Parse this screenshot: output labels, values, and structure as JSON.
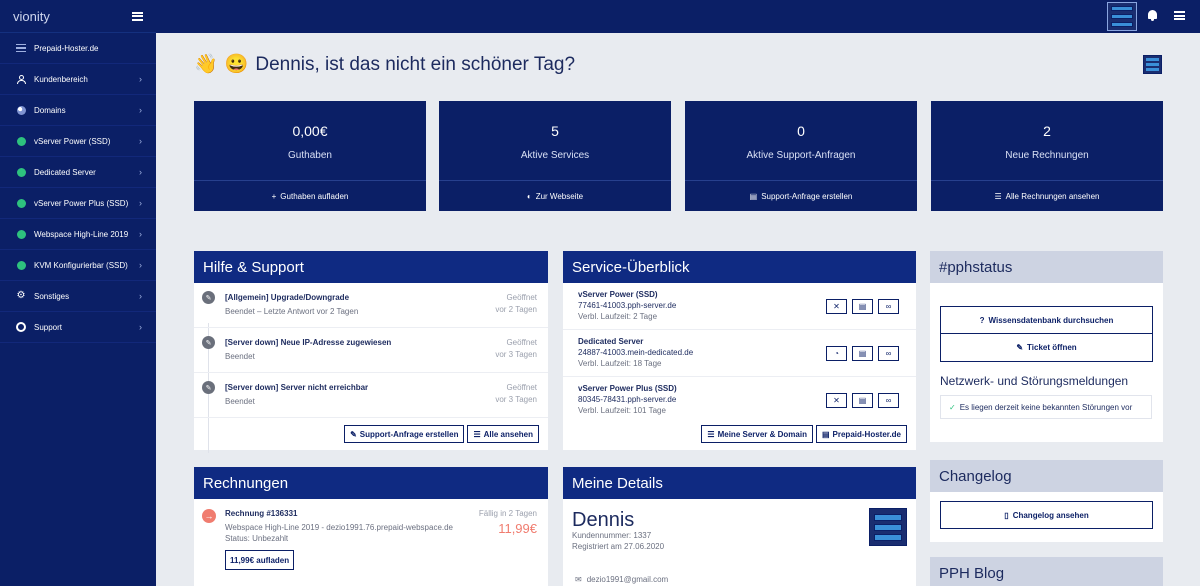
{
  "brand": "vionity",
  "sidebar": {
    "items": [
      {
        "label": "Prepaid-Hoster.de",
        "icon": "server-icon"
      },
      {
        "label": "Kundenbereich",
        "icon": "user-icon"
      },
      {
        "label": "Domains",
        "icon": "globe-icon"
      },
      {
        "label": "vServer Power (SSD)",
        "icon": "status-dot-icon"
      },
      {
        "label": "Dedicated Server",
        "icon": "status-dot-icon"
      },
      {
        "label": "vServer Power Plus (SSD)",
        "icon": "status-dot-icon"
      },
      {
        "label": "Webspace High-Line 2019",
        "icon": "status-dot-icon"
      },
      {
        "label": "KVM Konfigurierbar (SSD)",
        "icon": "status-dot-icon"
      },
      {
        "label": "Sonstiges",
        "icon": "gears-icon"
      },
      {
        "label": "Support",
        "icon": "lifebuoy-icon"
      }
    ]
  },
  "greeting": {
    "emoji1": "👋",
    "emoji2": "😀",
    "text": "Dennis, ist das nicht ein schöner Tag?"
  },
  "tiles": [
    {
      "value": "0,00€",
      "label": "Guthaben",
      "action": "Guthaben aufladen",
      "icon": "+"
    },
    {
      "value": "5",
      "label": "Aktive Services",
      "action": "Zur Webseite",
      "icon": "◐"
    },
    {
      "value": "0",
      "label": "Aktive Support-Anfragen",
      "action": "Support-Anfrage erstellen",
      "icon": "▤"
    },
    {
      "value": "2",
      "label": "Neue Rechnungen",
      "action": "Alle Rechnungen ansehen",
      "icon": "☰"
    }
  ],
  "support": {
    "title": "Hilfe & Support",
    "items": [
      {
        "title": "[Allgemein] Upgrade/Downgrade",
        "sub": "Beendet – Letzte Antwort vor 2 Tagen",
        "status": "Geöffnet",
        "time": "vor 2 Tagen"
      },
      {
        "title": "[Server down] Neue IP-Adresse zugewiesen",
        "sub": "Beendet",
        "status": "Geöffnet",
        "time": "vor 3 Tagen"
      },
      {
        "title": "[Server down] Server nicht erreichbar",
        "sub": "Beendet",
        "status": "Geöffnet",
        "time": "vor 3 Tagen"
      }
    ],
    "btn_create": "Support-Anfrage erstellen",
    "btn_all": "Alle ansehen"
  },
  "services": {
    "title": "Service-Überblick",
    "items": [
      {
        "name": "vServer Power (SSD)",
        "domain": "77461-41003.pph-server.de",
        "runtime": "Verbl. Laufzeit: 2 Tage"
      },
      {
        "name": "Dedicated Server",
        "domain": "24887-41003.mein-dedicated.de",
        "runtime": "Verbl. Laufzeit: 18 Tage"
      },
      {
        "name": "vServer Power Plus (SSD)",
        "domain": "80345-78431.pph-server.de",
        "runtime": "Verbl. Laufzeit: 101 Tage"
      }
    ],
    "btn_my": "Meine Server & Domain",
    "btn_ph": "Prepaid-Hoster.de"
  },
  "pphstatus": {
    "title": "#pphstatus",
    "btn_kb": "Wissensdatenbank durchsuchen",
    "btn_ticket": "Ticket öffnen",
    "heading": "Netzwerk- und Störungsmeldungen",
    "ok": "Es liegen derzeit keine bekannten Störungen vor"
  },
  "invoices": {
    "title": "Rechnungen",
    "item": {
      "title": "Rechnung #136331",
      "desc": "Webspace High-Line 2019 - dezio1991.76.prepaid-webspace.de",
      "status": "Status: Unbezahlt",
      "due": "Fällig in 2 Tagen",
      "amount": "11,99€",
      "btn": "11,99€ aufladen"
    },
    "accent": "#f07c6f"
  },
  "details": {
    "title": "Meine Details",
    "name": "Dennis",
    "customer": "Kundennummer: 1337",
    "registered": "Registriert am 27.06.2020",
    "email": "dezio1991@gmail.com"
  },
  "changelog": {
    "title": "Changelog",
    "btn": "Changelog ansehen"
  },
  "blog": {
    "title": "PPH Blog"
  },
  "colors": {
    "navy": "#0b1f66",
    "panel_head": "#0f2a82",
    "green": "#2ec27e",
    "red": "#f07c6f"
  }
}
